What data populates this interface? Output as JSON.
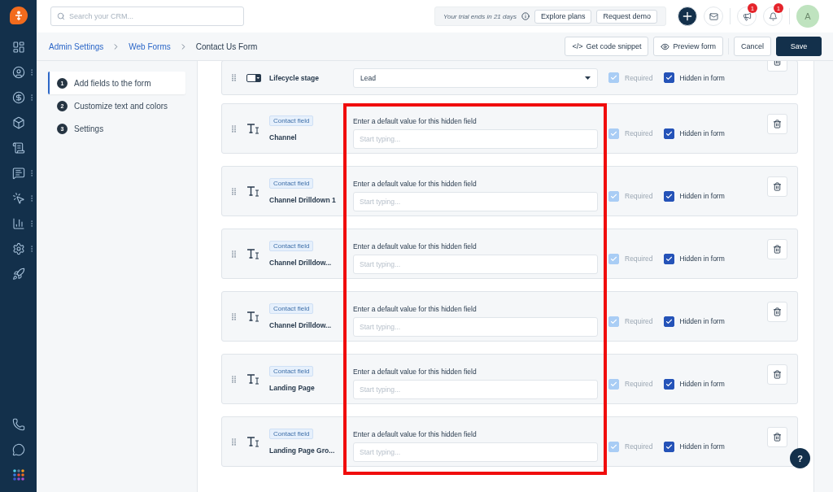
{
  "sidebar": {
    "items": [
      {
        "kind": "dashboard",
        "menu": false
      },
      {
        "kind": "contacts",
        "menu": true
      },
      {
        "kind": "deals",
        "menu": true
      },
      {
        "kind": "products",
        "menu": false
      },
      {
        "kind": "documents",
        "menu": false
      },
      {
        "kind": "conversations",
        "menu": true
      },
      {
        "kind": "automation",
        "menu": true
      },
      {
        "kind": "analytics",
        "menu": true
      },
      {
        "kind": "settings",
        "menu": true
      },
      {
        "kind": "launch",
        "menu": false
      }
    ],
    "bottom_items": [
      {
        "kind": "phone"
      },
      {
        "kind": "chat"
      },
      {
        "kind": "apps"
      }
    ]
  },
  "header": {
    "search": {
      "placeholder": "Search your CRM..."
    },
    "trial_text": "Your trial ends in 21 days",
    "buttons": [
      "Explore plans",
      "Request demo"
    ],
    "notifications": [
      {
        "kind": "updates",
        "count": "1"
      },
      {
        "kind": "alerts",
        "count": "1"
      }
    ],
    "avatar": "A"
  },
  "breadcrumbs": [
    {
      "label": "Admin Settings",
      "link": true
    },
    {
      "label": "Web Forms",
      "link": true
    },
    {
      "label": "Contact Us Form",
      "link": false
    }
  ],
  "actions": {
    "code_snippet": "Get code snippet",
    "code_glyph": "</>",
    "preview": "Preview form",
    "cancel": "Cancel",
    "save": "Save"
  },
  "steps": [
    {
      "number": "1",
      "label": "Add fields to the form",
      "selected": true
    },
    {
      "number": "2",
      "label": "Customize text and colors",
      "selected": false
    },
    {
      "number": "3",
      "label": "Settings",
      "selected": false
    }
  ],
  "fields": [
    {
      "kind": "dropdown",
      "name": "Lifecycle stage",
      "value": "Lead",
      "required": {
        "label": "Required",
        "checked": true,
        "disabled": true
      },
      "hidden": {
        "label": "Hidden in form",
        "checked": true
      }
    },
    {
      "kind": "text",
      "tag": "Contact field",
      "name": "Channel",
      "label": "Enter a default value for this hidden field",
      "placeholder": "Start typing...",
      "required": {
        "label": "Required",
        "checked": true,
        "disabled": true
      },
      "hidden": {
        "label": "Hidden in form",
        "checked": true
      }
    },
    {
      "kind": "text",
      "tag": "Contact field",
      "name": "Channel Drilldown 1",
      "label": "Enter a default value for this hidden field",
      "placeholder": "Start typing...",
      "required": {
        "label": "Required",
        "checked": true,
        "disabled": true
      },
      "hidden": {
        "label": "Hidden in form",
        "checked": true
      }
    },
    {
      "kind": "text",
      "tag": "Contact field",
      "name": "Channel Drilldow...",
      "label": "Enter a default value for this hidden field",
      "placeholder": "Start typing...",
      "required": {
        "label": "Required",
        "checked": true,
        "disabled": true
      },
      "hidden": {
        "label": "Hidden in form",
        "checked": true
      }
    },
    {
      "kind": "text",
      "tag": "Contact field",
      "name": "Channel Drilldow...",
      "label": "Enter a default value for this hidden field",
      "placeholder": "Start typing...",
      "required": {
        "label": "Required",
        "checked": true,
        "disabled": true
      },
      "hidden": {
        "label": "Hidden in form",
        "checked": true
      }
    },
    {
      "kind": "text",
      "tag": "Contact field",
      "name": "Landing Page",
      "label": "Enter a default value for this hidden field",
      "placeholder": "Start typing...",
      "required": {
        "label": "Required",
        "checked": true,
        "disabled": true
      },
      "hidden": {
        "label": "Hidden in form",
        "checked": true
      }
    },
    {
      "kind": "text",
      "tag": "Contact field",
      "name": "Landing Page Gro...",
      "label": "Enter a default value for this hidden field",
      "placeholder": "Start typing...",
      "required": {
        "label": "Required",
        "checked": true,
        "disabled": true
      },
      "hidden": {
        "label": "Hidden in form",
        "checked": true
      }
    }
  ],
  "help_button": "?"
}
